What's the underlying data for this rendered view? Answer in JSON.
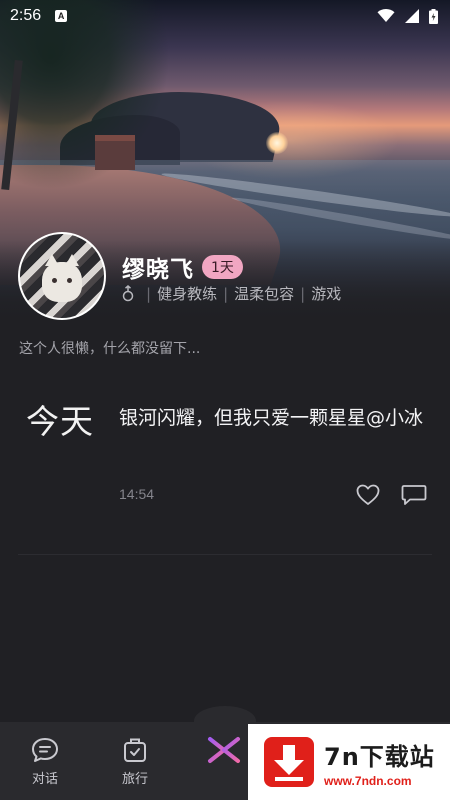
{
  "status_bar": {
    "time": "2:56",
    "notification_glyph": "A"
  },
  "profile": {
    "name": "缪晓飞",
    "badge": "1天",
    "tags": [
      "健身教练",
      "温柔包容",
      "游戏"
    ],
    "bio": "这个人很懒，什么都没留下..."
  },
  "post": {
    "date_label": "今天",
    "text": "银河闪耀，但我只爱一颗星星@小冰",
    "time": "14:54"
  },
  "bottom_nav": {
    "items": [
      {
        "label": "对话",
        "icon": "chat-bubble-icon"
      },
      {
        "label": "旅行",
        "icon": "suitcase-icon"
      }
    ],
    "center_icon": "x-logo-icon"
  },
  "watermark": {
    "title": "7n下载站",
    "url": "www.7ndn.com"
  },
  "colors": {
    "background": "#202024",
    "badge": "#f1a6c2",
    "nav_bg": "#2a2a2e",
    "watermark_red": "#e0201a"
  }
}
